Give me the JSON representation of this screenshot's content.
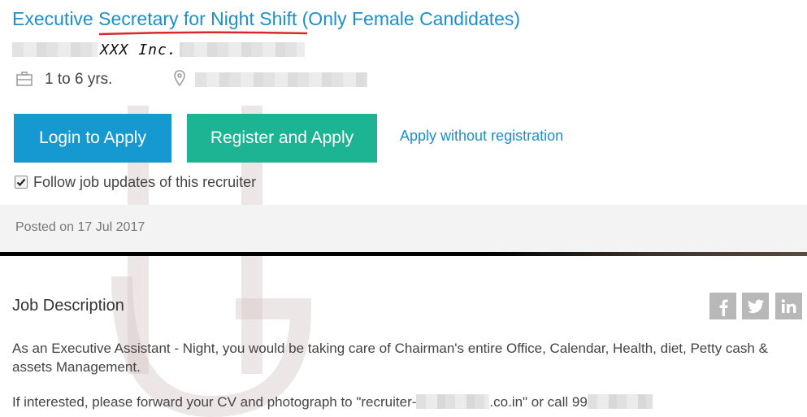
{
  "job": {
    "title": "Executive Secretary for Night Shift (Only Female Candidates)",
    "company": "XXX Inc.",
    "experience": "1 to 6 yrs."
  },
  "actions": {
    "login_label": "Login to Apply",
    "register_label": "Register and Apply",
    "apply_link": "Apply without registration"
  },
  "follow": {
    "label": "Follow job updates of this recruiter",
    "checked": true
  },
  "posted": "Posted on 17 Jul 2017",
  "description": {
    "heading": "Job Description",
    "paragraph1": "As an Executive Assistant - Night, you would be taking care of Chairman's entire Office, Calendar, Health, diet, Petty cash & assets Management.",
    "p2_prefix": "If interested, please forward your CV and photograph to \"recruiter-",
    "p2_domain": ".co.in\" or call 99"
  },
  "social": [
    {
      "icon": "facebook-icon"
    },
    {
      "icon": "twitter-icon"
    },
    {
      "icon": "linkedin-icon"
    }
  ],
  "colors": {
    "link": "#1e8fcb",
    "login_button": "#1698d1",
    "register_button": "#1cb493",
    "underline": "#d9272e",
    "social": "#b8b8b8"
  }
}
